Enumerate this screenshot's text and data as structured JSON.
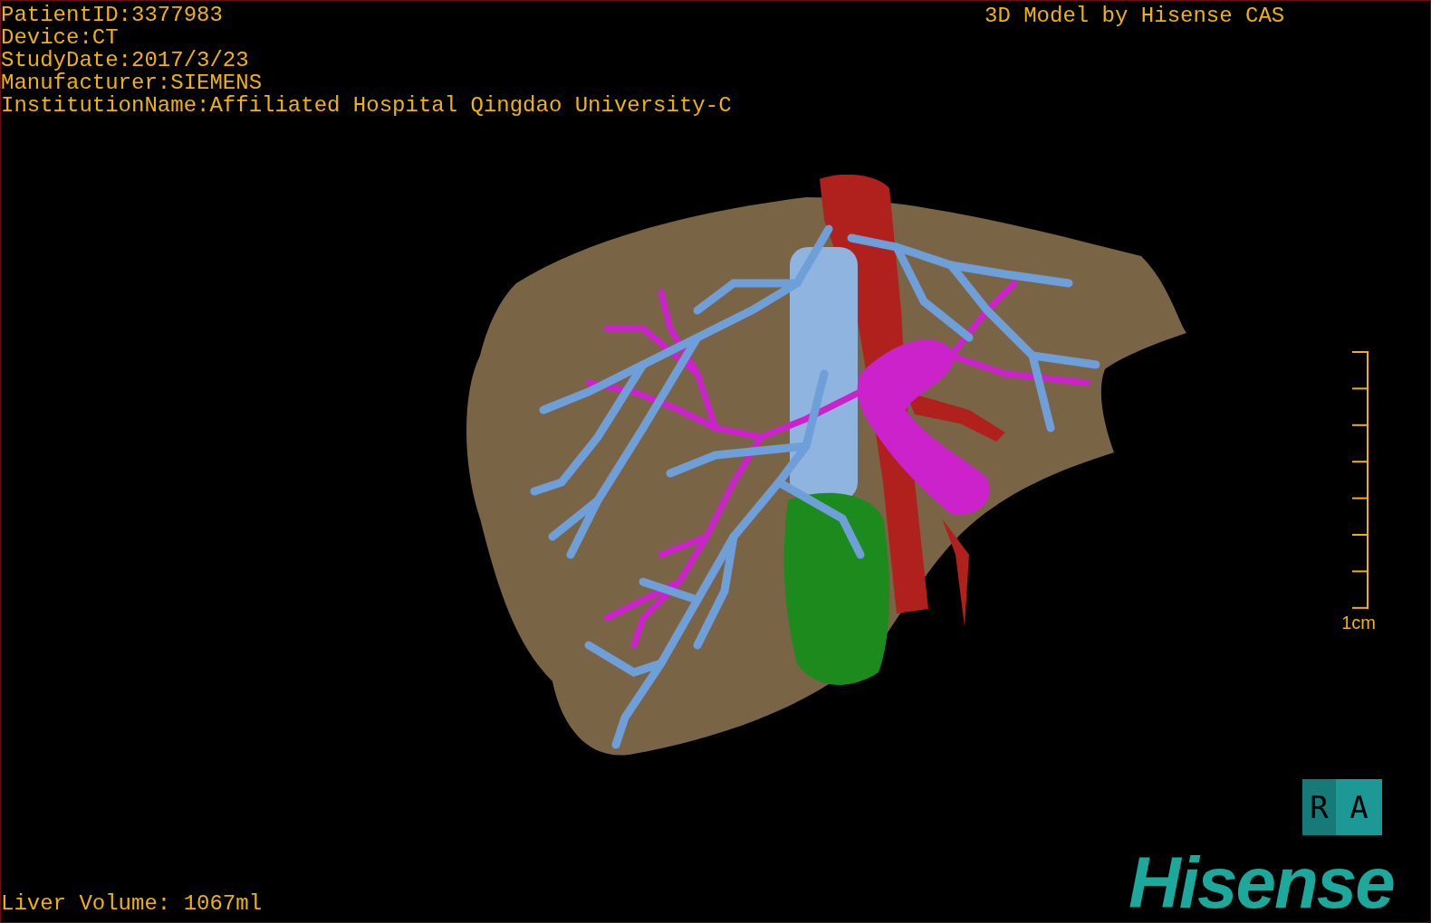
{
  "patient_info": [
    "PatientID:3377983",
    "Device:CT",
    "StudyDate:2017/3/23",
    "Manufacturer:SIEMENS",
    "InstitutionName:Affiliated Hospital Qingdao University-C"
  ],
  "model_credit": "3D Model by Hisense CAS",
  "scale_bar": {
    "label": "1cm"
  },
  "orientation_cube": {
    "left_face": "R",
    "front_face": "A"
  },
  "liver_volume": "Liver Volume: 1067ml",
  "logo": "Hisense"
}
